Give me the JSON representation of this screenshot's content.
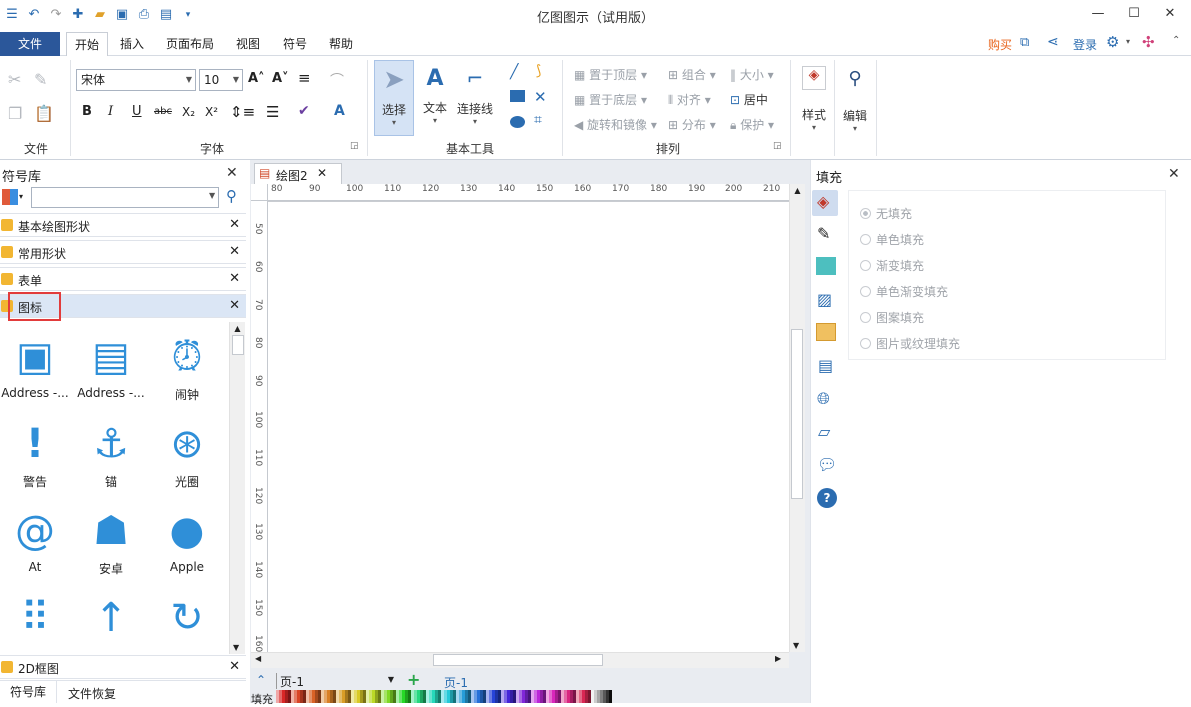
{
  "window": {
    "title": "亿图图示（试用版）"
  },
  "menu": {
    "file": "文件",
    "tabs": [
      "开始",
      "插入",
      "页面布局",
      "视图",
      "符号",
      "帮助"
    ],
    "right": {
      "buy": "购买",
      "login": "登录"
    }
  },
  "ribbon": {
    "file_group": "文件",
    "font_group": "字体",
    "font_name": "宋体",
    "font_size": "10",
    "tools_group": "基本工具",
    "select": "选择",
    "text": "文本",
    "connector": "连接线",
    "arrange_group": "排列",
    "bring_top": "置于顶层",
    "send_bottom": "置于底层",
    "rotate_mirror": "旋转和镜像",
    "group": "组合",
    "align": "对齐",
    "distribute": "分布",
    "size": "大小",
    "center": "居中",
    "protect": "保护",
    "style": "样式",
    "edit": "编辑"
  },
  "library": {
    "title": "符号库",
    "search_placeholder": "",
    "sections": [
      "基本绘图形状",
      "常用形状",
      "表单",
      "图标"
    ],
    "footer_section": "2D框图",
    "icons": [
      {
        "label": "Address -...",
        "icon": "address-book-icon"
      },
      {
        "label": "Address -...",
        "icon": "address-card-icon"
      },
      {
        "label": "闹钟",
        "icon": "alarm-clock-icon"
      },
      {
        "label": "警告",
        "icon": "warning-icon"
      },
      {
        "label": "锚",
        "icon": "anchor-icon"
      },
      {
        "label": "光圈",
        "icon": "aperture-icon"
      },
      {
        "label": "At",
        "icon": "at-icon"
      },
      {
        "label": "安卓",
        "icon": "android-icon"
      },
      {
        "label": "Apple",
        "icon": "apple-icon"
      }
    ],
    "bottom_tabs": [
      "符号库",
      "文件恢复"
    ]
  },
  "document": {
    "tab": "绘图2",
    "ruler_h": [
      "80",
      "90",
      "100",
      "110",
      "120",
      "130",
      "140",
      "150",
      "160",
      "170",
      "180",
      "190",
      "200",
      "210"
    ],
    "ruler_v": [
      "50",
      "60",
      "70",
      "80",
      "90",
      "100",
      "110",
      "120",
      "130",
      "140",
      "150",
      "160"
    ],
    "page_select": "页-1",
    "page_tab": "页-1",
    "fill_label": "填充"
  },
  "fill_panel": {
    "title": "填充",
    "options": [
      "无填充",
      "单色填充",
      "渐变填充",
      "单色渐变填充",
      "图案填充",
      "图片或纹理填充"
    ]
  },
  "colors": {
    "accent": "#2b579a",
    "icon_blue": "#2f8fd8",
    "highlight_red": "#e23b3b",
    "buy_orange": "#e8641c"
  }
}
